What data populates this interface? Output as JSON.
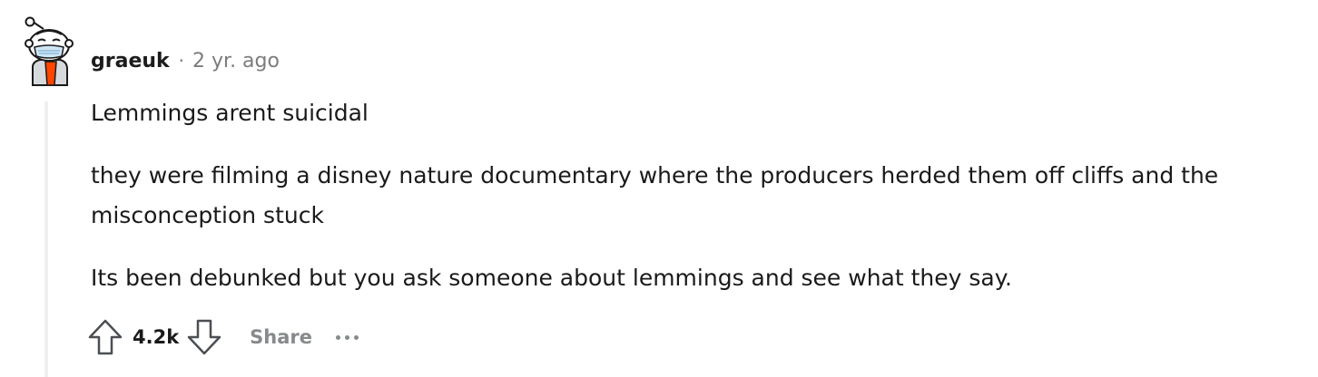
{
  "comment": {
    "author": "graeuk",
    "separator": "·",
    "timestamp": "2 yr. ago",
    "paragraphs": [
      "Lemmings arent suicidal",
      "they were filming a disney nature documentary where the producers herded them off cliffs and the misconception stuck",
      "Its been debunked but you ask someone about lemmings and see what they say."
    ],
    "score": "4.2k",
    "share_label": "Share",
    "avatar_icon": "snoo-avatar-icon",
    "upvote_icon": "upvote-arrow-icon",
    "downvote_icon": "downvote-arrow-icon",
    "more_icon": "more-options-icon"
  },
  "colors": {
    "text": "#1a1a1b",
    "meta": "#7c7c7c",
    "action": "#878a8c",
    "thread_line": "#edeff1",
    "avatar_accent": "#ff4500"
  }
}
